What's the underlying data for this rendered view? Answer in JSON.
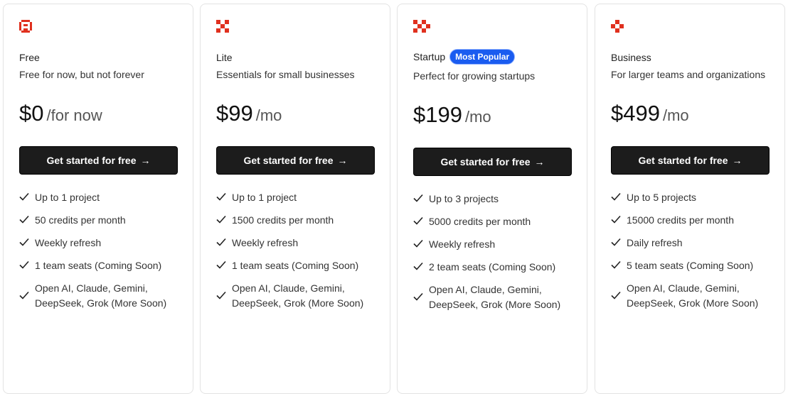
{
  "colors": {
    "brand_red": "#e0301e",
    "badge_blue": "#1a5cf0",
    "button_bg": "#1c1c1c"
  },
  "plans": [
    {
      "name": "Free",
      "subtitle": "Free for now, but not forever",
      "price": "$0",
      "period": "/for now",
      "cta_label": "Get started for free",
      "cta_arrow": "→",
      "icon": "smile-pixel-icon",
      "features": [
        "Up to 1 project",
        "50 credits per month",
        "Weekly refresh",
        "1 team seats (Coming Soon)",
        "Open AI, Claude, Gemini, DeepSeek, Grok (More Soon)"
      ]
    },
    {
      "name": "Lite",
      "subtitle": "Essentials for small businesses",
      "price": "$99",
      "period": "/mo",
      "cta_label": "Get started for free",
      "cta_arrow": "→",
      "icon": "checker-pixel-icon",
      "features": [
        "Up to 1 project",
        "1500 credits per month",
        "Weekly refresh",
        "1 team seats (Coming Soon)",
        "Open AI, Claude, Gemini, DeepSeek, Grok (More Soon)"
      ]
    },
    {
      "name": "Startup",
      "badge": "Most Popular",
      "subtitle": "Perfect for growing startups",
      "price": "$199",
      "period": "/mo",
      "cta_label": "Get started for free",
      "cta_arrow": "→",
      "icon": "double-checker-pixel-icon",
      "features": [
        "Up to 3 projects",
        "5000 credits per month",
        "Weekly refresh",
        "2 team seats (Coming Soon)",
        "Open AI, Claude, Gemini, DeepSeek, Grok (More Soon)"
      ]
    },
    {
      "name": "Business",
      "subtitle": "For larger teams and organizations",
      "price": "$499",
      "period": "/mo",
      "cta_label": "Get started for free",
      "cta_arrow": "→",
      "icon": "diamond-pixel-icon",
      "features": [
        "Up to 5 projects",
        "15000 credits per month",
        "Daily refresh",
        "5 team seats (Coming Soon)",
        "Open AI, Claude, Gemini, DeepSeek, Grok (More Soon)"
      ]
    }
  ]
}
